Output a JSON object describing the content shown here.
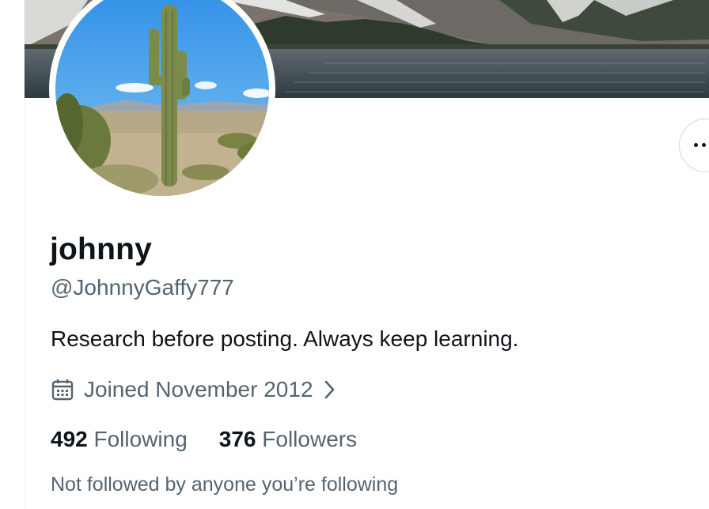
{
  "profile": {
    "display_name": "johnny",
    "handle": "@JohnnyGaffy777",
    "bio": "Research before posting. Always keep learning.",
    "joined": "Joined November 2012",
    "following_count": "492",
    "following_label": "Following",
    "followers_count": "376",
    "followers_label": "Followers",
    "followed_by_note": "Not followed by anyone you’re following"
  },
  "icons": {
    "more": "more-icon",
    "calendar": "calendar-icon",
    "chevron": "chevron-right-icon"
  },
  "colors": {
    "text_primary": "#0f1419",
    "text_secondary": "#536471",
    "border": "#cfd9de"
  }
}
